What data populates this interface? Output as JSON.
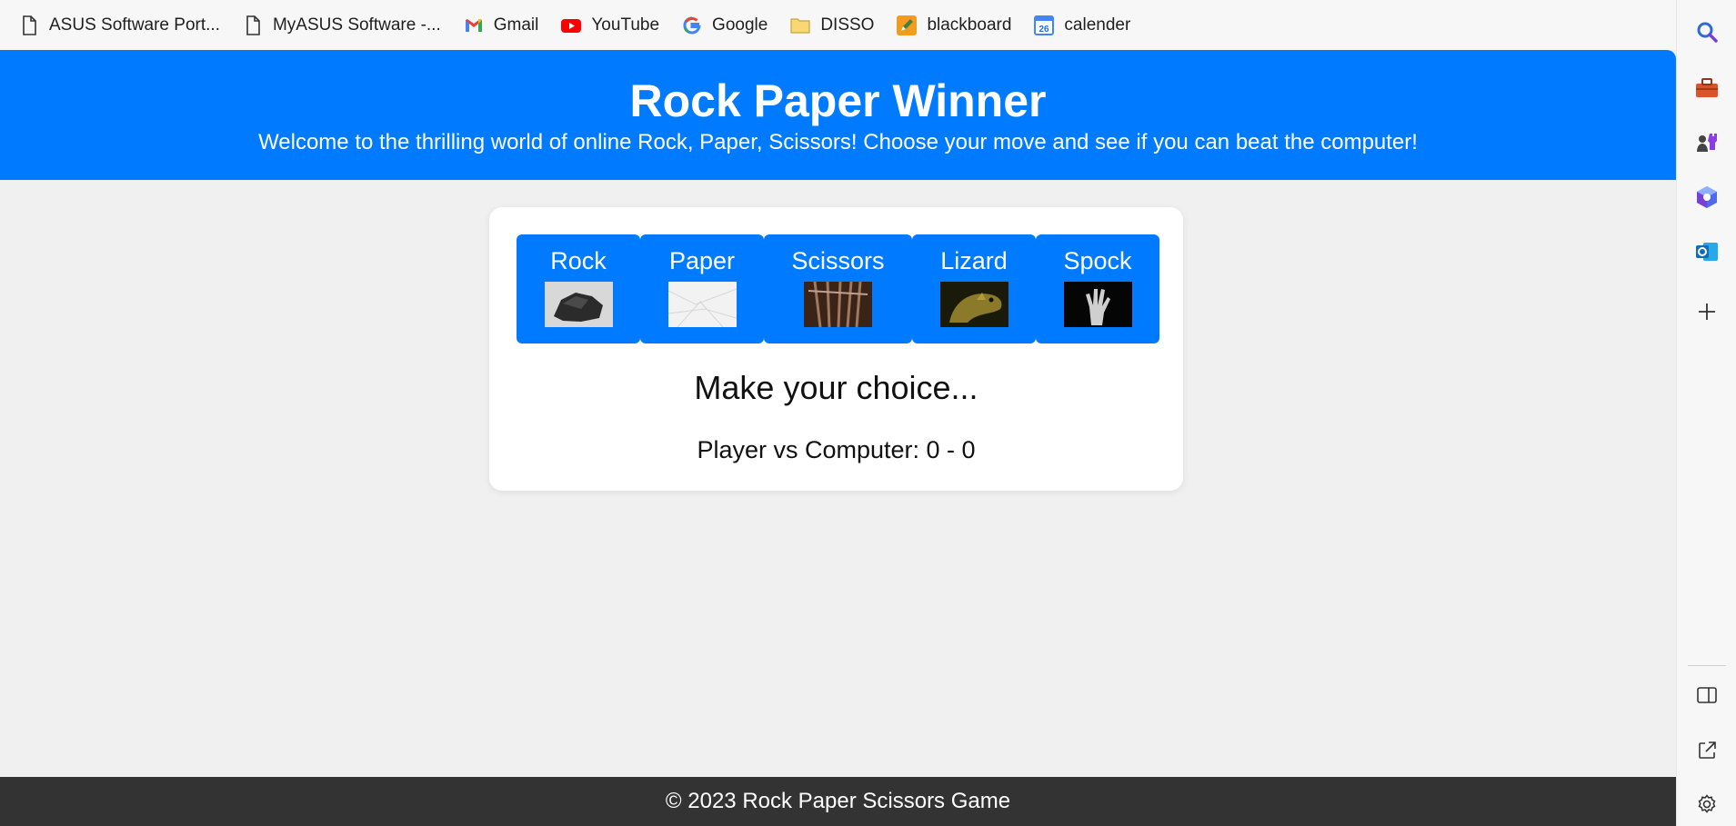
{
  "bookmarks": [
    {
      "label": "ASUS Software Port...",
      "icon": "page-icon"
    },
    {
      "label": "MyASUS Software -...",
      "icon": "page-icon"
    },
    {
      "label": "Gmail",
      "icon": "gmail-icon"
    },
    {
      "label": "YouTube",
      "icon": "youtube-icon"
    },
    {
      "label": "Google",
      "icon": "google-icon"
    },
    {
      "label": "DISSO",
      "icon": "folder-icon"
    },
    {
      "label": "blackboard",
      "icon": "blackboard-icon"
    },
    {
      "label": "calender",
      "icon": "calendar-icon",
      "badge": "26"
    }
  ],
  "header": {
    "title": "Rock Paper Winner",
    "subtitle": "Welcome to the thrilling world of online Rock, Paper, Scissors! Choose your move and see if you can beat the computer!"
  },
  "game": {
    "choices": [
      {
        "label": "Rock",
        "image": "rock-image"
      },
      {
        "label": "Paper",
        "image": "paper-image"
      },
      {
        "label": "Scissors",
        "image": "scissors-image"
      },
      {
        "label": "Lizard",
        "image": "lizard-image"
      },
      {
        "label": "Spock",
        "image": "spock-hand-image"
      }
    ],
    "result": "Make your choice...",
    "score": "Player vs Computer: 0 - 0"
  },
  "footer": {
    "text": "© 2023 Rock Paper Scissors Game"
  },
  "sidebar": {
    "items": [
      "search-icon",
      "tools-icon",
      "games-icon",
      "copilot-icon",
      "outlook-icon",
      "add-icon"
    ],
    "bottom": [
      "split-screen-icon",
      "open-external-icon",
      "settings-icon"
    ]
  },
  "colors": {
    "primary": "#007bff",
    "footer": "#333333",
    "background": "#f0f0f0"
  }
}
